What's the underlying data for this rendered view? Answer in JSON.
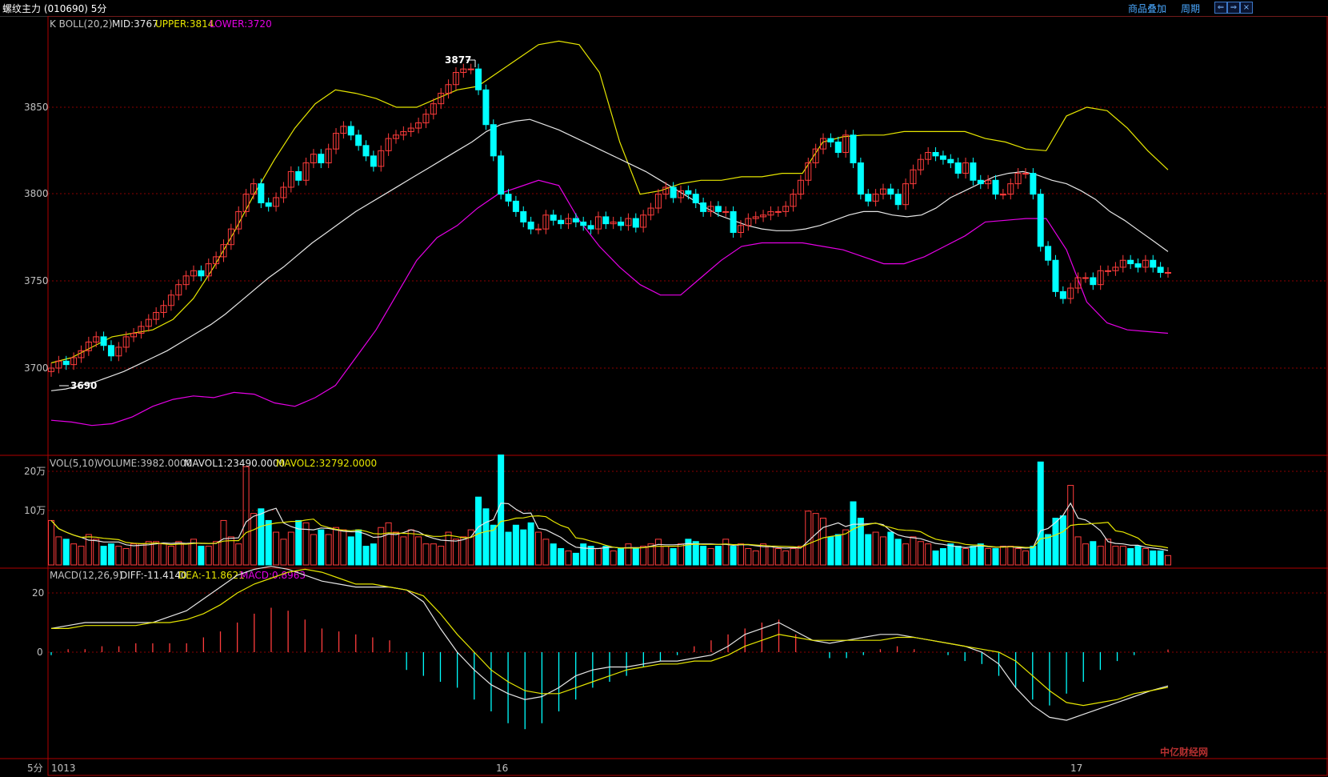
{
  "header": {
    "title": "螺纹主力 (010690) 5分",
    "btn_overlay": "商品叠加",
    "btn_period": "周期",
    "win_prev": "⇐",
    "win_next": "⇒",
    "win_close": "×"
  },
  "indicators": {
    "boll_name": "K  BOLL(20,2)",
    "boll_mid": "MID:3767",
    "boll_upper": "UPPER:3814",
    "boll_lower": "LOWER:3720",
    "vol_name": "VOL(5,10)",
    "vol_volume": "VOLUME:3982.0000",
    "vol_mavol1": "MAVOL1:23490.0000",
    "vol_mavol2": "MAVOL2:32792.0000",
    "macd_name": "MACD(12,26,9)",
    "macd_diff": "DIFF:-11.4140",
    "macd_dea": "DEA:-11.8621",
    "macd_val": "MACD:0.8963"
  },
  "annotations": {
    "high": "3877",
    "low": "3690"
  },
  "axes": {
    "price_ticks": [
      "3850",
      "3800",
      "3750",
      "3700"
    ],
    "vol_ticks": [
      "20万",
      "10万"
    ],
    "macd_ticks": [
      "20",
      "0"
    ],
    "period_label": "5分",
    "date_labels": [
      "1013",
      "16",
      "17"
    ]
  },
  "watermark": "中亿财经网",
  "colors": {
    "up": "#ff3c3c",
    "down": "#00ffff",
    "mid": "#e6e6e6",
    "upper": "#e6e600",
    "lower": "#e600e6",
    "grid": "#8b0000"
  },
  "chart_data": {
    "type": "candlestick",
    "price_range": [
      3660,
      3900
    ],
    "volume_range": [
      0,
      250000
    ],
    "macd_range": [
      -32,
      30
    ],
    "closes": [
      3700,
      3704,
      3702,
      3706,
      3710,
      3715,
      3718,
      3713,
      3707,
      3712,
      3718,
      3720,
      3724,
      3728,
      3732,
      3736,
      3742,
      3748,
      3753,
      3756,
      3753,
      3760,
      3764,
      3771,
      3780,
      3790,
      3800,
      3806,
      3795,
      3793,
      3798,
      3804,
      3813,
      3808,
      3818,
      3823,
      3818,
      3826,
      3835,
      3839,
      3834,
      3828,
      3822,
      3816,
      3825,
      3832,
      3834,
      3836,
      3838,
      3841,
      3846,
      3852,
      3858,
      3863,
      3870,
      3872,
      3872,
      3860,
      3840,
      3822,
      3800,
      3796,
      3790,
      3784,
      3780,
      3780,
      3788,
      3785,
      3783,
      3786,
      3784,
      3782,
      3780,
      3787,
      3783,
      3784,
      3782,
      3786,
      3781,
      3788,
      3792,
      3800,
      3804,
      3798,
      3802,
      3800,
      3795,
      3790,
      3793,
      3790,
      3790,
      3778,
      3782,
      3786,
      3787,
      3788,
      3790,
      3790,
      3793,
      3800,
      3808,
      3818,
      3826,
      3832,
      3830,
      3824,
      3834,
      3818,
      3800,
      3796,
      3800,
      3803,
      3800,
      3794,
      3806,
      3814,
      3820,
      3824,
      3822,
      3820,
      3818,
      3812,
      3818,
      3808,
      3806,
      3808,
      3800,
      3800,
      3806,
      3812,
      3812,
      3800,
      3770,
      3762,
      3744,
      3740,
      3746,
      3752,
      3752,
      3748,
      3756,
      3756,
      3758,
      3762,
      3760,
      3758,
      3762,
      3758,
      3755,
      3755
    ],
    "volume": [
      95000,
      60000,
      55000,
      45000,
      40000,
      65000,
      55000,
      40000,
      45000,
      40000,
      35000,
      45000,
      45000,
      50000,
      50000,
      45000,
      40000,
      50000,
      45000,
      55000,
      40000,
      40000,
      50000,
      95000,
      60000,
      45000,
      210000,
      110000,
      120000,
      95000,
      70000,
      55000,
      70000,
      95000,
      90000,
      65000,
      75000,
      65000,
      80000,
      75000,
      60000,
      75000,
      40000,
      45000,
      80000,
      90000,
      70000,
      60000,
      75000,
      60000,
      45000,
      45000,
      40000,
      70000,
      55000,
      60000,
      75000,
      145000,
      120000,
      85000,
      235000,
      70000,
      85000,
      75000,
      90000,
      70000,
      55000,
      45000,
      35000,
      30000,
      25000,
      45000,
      40000,
      35000,
      40000,
      30000,
      35000,
      45000,
      35000,
      40000,
      45000,
      55000,
      40000,
      35000,
      45000,
      55000,
      50000,
      40000,
      35000,
      40000,
      55000,
      40000,
      45000,
      35000,
      30000,
      45000,
      40000,
      35000,
      30000,
      35000,
      40000,
      115000,
      110000,
      100000,
      60000,
      65000,
      75000,
      135000,
      100000,
      65000,
      70000,
      60000,
      70000,
      55000,
      45000,
      60000,
      50000,
      45000,
      30000,
      35000,
      45000,
      40000,
      35000,
      40000,
      45000,
      35000,
      35000,
      40000,
      40000,
      35000,
      30000,
      40000,
      220000,
      65000,
      100000,
      105000,
      170000,
      60000,
      45000,
      50000,
      40000,
      55000,
      40000,
      40000,
      35000,
      40000,
      35000,
      30000,
      30000,
      20000
    ],
    "mid_line": [
      3687,
      3688,
      3690,
      3692,
      3695,
      3698,
      3702,
      3706,
      3710,
      3715,
      3720,
      3725,
      3731,
      3738,
      3745,
      3752,
      3758,
      3765,
      3772,
      3778,
      3784,
      3790,
      3795,
      3800,
      3805,
      3810,
      3815,
      3820,
      3825,
      3830,
      3836,
      3840,
      3842,
      3843,
      3840,
      3837,
      3833,
      3829,
      3825,
      3821,
      3817,
      3813,
      3808,
      3803,
      3798,
      3793,
      3788,
      3785,
      3782,
      3780,
      3779,
      3779,
      3780,
      3782,
      3785,
      3788,
      3790,
      3790,
      3788,
      3787,
      3788,
      3792,
      3798,
      3802,
      3806,
      3810,
      3812,
      3813,
      3811,
      3808,
      3806,
      3802,
      3797,
      3790,
      3785,
      3779,
      3773,
      3767
    ],
    "upper_line": [
      3703,
      3706,
      3712,
      3718,
      3720,
      3722,
      3728,
      3740,
      3758,
      3778,
      3800,
      3820,
      3838,
      3852,
      3860,
      3858,
      3855,
      3850,
      3850,
      3855,
      3860,
      3862,
      3870,
      3878,
      3886,
      3888,
      3886,
      3870,
      3830,
      3800,
      3802,
      3806,
      3808,
      3808,
      3810,
      3810,
      3812,
      3812,
      3830,
      3833,
      3834,
      3834,
      3836,
      3836,
      3836,
      3836,
      3832,
      3830,
      3826,
      3825,
      3845,
      3850,
      3848,
      3838,
      3825,
      3814
    ],
    "lower_line": [
      3670,
      3669,
      3667,
      3668,
      3672,
      3678,
      3682,
      3684,
      3683,
      3686,
      3685,
      3680,
      3678,
      3683,
      3690,
      3706,
      3722,
      3742,
      3762,
      3775,
      3782,
      3792,
      3800,
      3804,
      3808,
      3805,
      3785,
      3770,
      3758,
      3748,
      3742,
      3742,
      3752,
      3762,
      3770,
      3772,
      3772,
      3772,
      3770,
      3768,
      3764,
      3760,
      3760,
      3764,
      3770,
      3776,
      3784,
      3785,
      3786,
      3786,
      3768,
      3738,
      3726,
      3722,
      3721,
      3720
    ],
    "diff": [
      8,
      9,
      10,
      10,
      10,
      10,
      10,
      12,
      14,
      18,
      22,
      26,
      28,
      29,
      28,
      26,
      24,
      23,
      22,
      22,
      22,
      21,
      17,
      8,
      0,
      -6,
      -11,
      -14,
      -16,
      -15,
      -12,
      -8,
      -6,
      -5,
      -5,
      -4,
      -3,
      -3,
      -2,
      -1,
      2,
      6,
      8,
      10,
      7,
      4,
      3,
      4,
      5,
      6,
      6,
      5,
      4,
      3,
      2,
      0,
      -4,
      -12,
      -18,
      -22,
      -23,
      -21,
      -19,
      -17,
      -15,
      -13,
      -11.4
    ],
    "dea": [
      8,
      8,
      9,
      9,
      9,
      9,
      10,
      10,
      11,
      13,
      16,
      20,
      23,
      25,
      27,
      28,
      27,
      25,
      23,
      23,
      22,
      21,
      19,
      13,
      6,
      0,
      -6,
      -10,
      -13,
      -14,
      -14,
      -12,
      -10,
      -8,
      -6,
      -5,
      -4,
      -4,
      -3,
      -3,
      -1,
      2,
      4,
      6,
      5,
      4,
      4,
      4,
      4,
      4,
      5,
      5,
      4,
      3,
      2,
      1,
      0,
      -3,
      -8,
      -13,
      -17,
      -18,
      -17,
      -16,
      -14,
      -13,
      -11.86
    ],
    "macd": [
      -1,
      1,
      1,
      2,
      2,
      3,
      3,
      3,
      3,
      5,
      7,
      10,
      13,
      15,
      14,
      11,
      8,
      7,
      6,
      5,
      4,
      -6,
      -8,
      -10,
      -12,
      -16,
      -20,
      -24,
      -26,
      -24,
      -20,
      -16,
      -12,
      -10,
      -8,
      -5,
      -3,
      -1,
      2,
      4,
      6,
      8,
      10,
      11,
      6,
      0,
      -2,
      -2,
      -1,
      1,
      2,
      1,
      0,
      -1,
      -3,
      -4,
      -8,
      -12,
      -16,
      -18,
      -14,
      -10,
      -6,
      -3,
      -1,
      0,
      0.9
    ]
  }
}
